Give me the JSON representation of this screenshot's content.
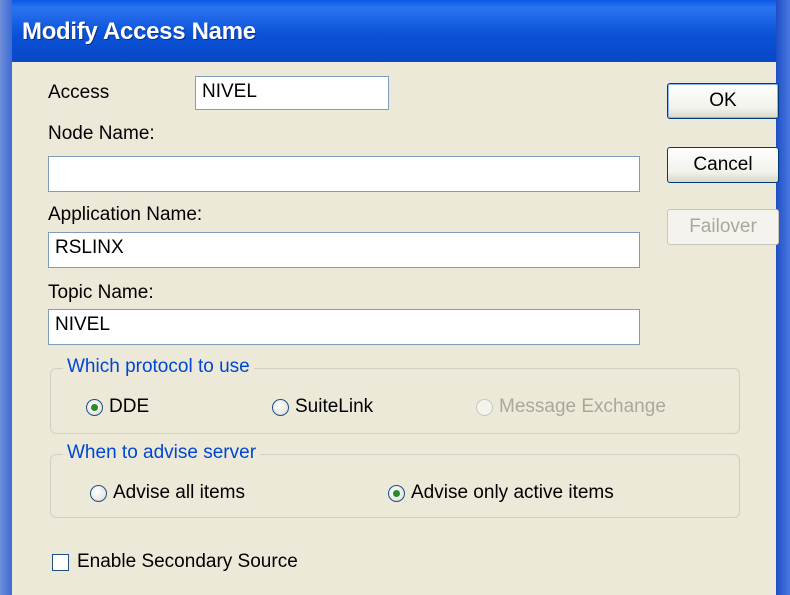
{
  "dialog": {
    "title": "Modify Access Name"
  },
  "form": {
    "access_label": "Access",
    "access_value": "NIVEL",
    "node_label": "Node Name:",
    "node_value": "",
    "app_label": "Application Name:",
    "app_value": "RSLINX",
    "topic_label": "Topic Name:",
    "topic_value": "NIVEL"
  },
  "buttons": {
    "ok": "OK",
    "cancel": "Cancel",
    "failover": "Failover"
  },
  "protocol": {
    "legend": "Which protocol to use",
    "options": [
      "DDE",
      "SuiteLink",
      "Message Exchange"
    ],
    "selected": "DDE"
  },
  "advise": {
    "legend": "When to advise server",
    "options": [
      "Advise all items",
      "Advise only active items"
    ],
    "selected": "Advise only active items"
  },
  "secondary": {
    "label": "Enable Secondary Source",
    "checked": false
  },
  "colors": {
    "title_bar": "#0b52d8",
    "legend_text": "#0046d5",
    "dialog_bg": "#ece9d8"
  }
}
